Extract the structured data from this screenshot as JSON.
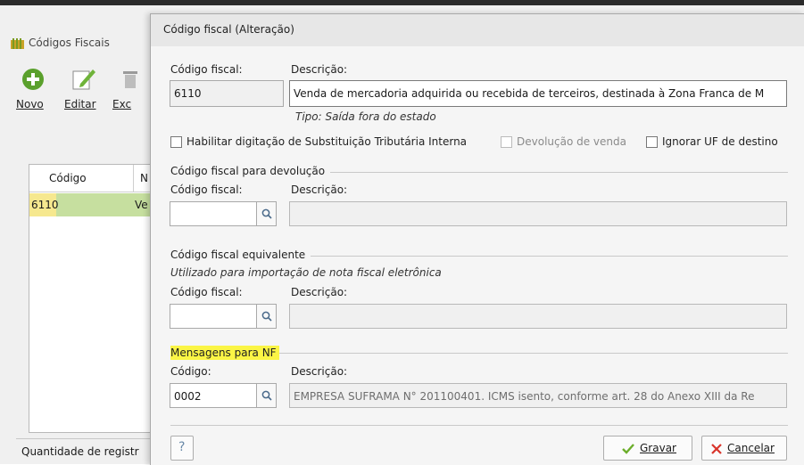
{
  "background_window": {
    "title": "Códigos Fiscais",
    "toolbar": {
      "novo_label": "Novo",
      "editar_label": "Editar",
      "excluir_label": "Exc"
    },
    "list": {
      "columns": [
        "Código",
        "N"
      ],
      "rows": [
        {
          "code": "6110",
          "desc": "Ve"
        }
      ]
    },
    "status_text": "Quantidade de registr"
  },
  "dialog": {
    "title": "Código fiscal (Alteração)",
    "codigo_fiscal_label": "Código fiscal:",
    "descricao_label": "Descrição:",
    "codigo_fiscal_value": "6110",
    "descricao_value": "Venda de mercadoria adquirida ou recebida de terceiros, destinada à Zona Franca de M",
    "tipo_text": "Tipo: Saída fora do estado",
    "checkboxes": {
      "substituicao_label": "Habilitar digitação de Substituição Tributária Interna",
      "devolucao_venda_label": "Devolução de venda",
      "ignorar_uf_label": "Ignorar UF de destino"
    },
    "devolucao_section": {
      "title": "Código fiscal para devolução",
      "codigo_label": "Código fiscal:",
      "descricao_label": "Descrição:",
      "codigo_value": "",
      "descricao_value": ""
    },
    "equivalente_section": {
      "title": "Código fiscal equivalente",
      "subtitle": "Utilizado para importação de nota fiscal eletrônica",
      "codigo_label": "Código fiscal:",
      "descricao_label": "Descrição:",
      "codigo_value": "",
      "descricao_value": ""
    },
    "mensagens_section": {
      "title": "Mensagens para NF",
      "highlight_color": "#fbf545",
      "codigo_label": "Código:",
      "descricao_label": "Descrição:",
      "codigo_value": "0002",
      "descricao_value": "EMPRESA SUFRAMA N° 201100401. ICMS isento, conforme art. 28 do Anexo XIII da Re"
    },
    "help_label": "?",
    "gravar_label": "Gravar",
    "cancelar_label": "Cancelar",
    "colors": {
      "gravar_check": "#6cae2b",
      "cancelar_x": "#d9342b"
    }
  }
}
